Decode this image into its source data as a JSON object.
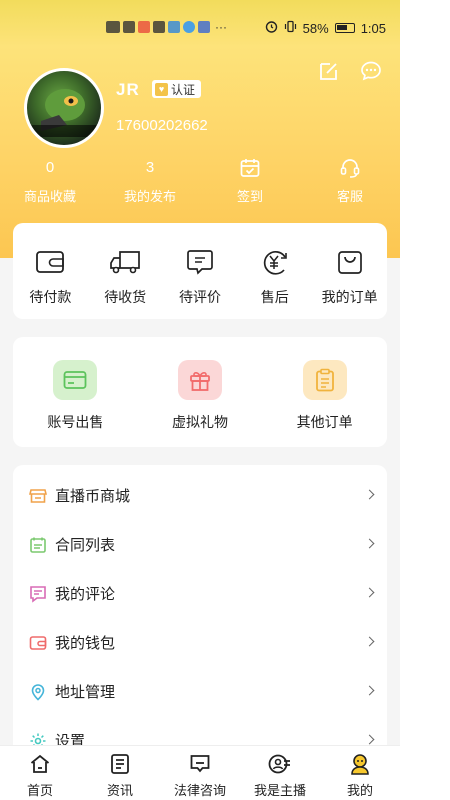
{
  "status_bar": {
    "battery": "58%",
    "time": "1:05",
    "more": "···"
  },
  "profile": {
    "name": "JR",
    "verify_label": "认证",
    "phone": "17600202662"
  },
  "stats": [
    {
      "value": "0",
      "label": "商品收藏"
    },
    {
      "value": "3",
      "label": "我的发布"
    },
    {
      "icon": "calendar-check-icon",
      "label": "签到"
    },
    {
      "icon": "headset-icon",
      "label": "客服"
    }
  ],
  "orders": [
    {
      "icon": "wallet-icon",
      "label": "待付款"
    },
    {
      "icon": "truck-icon",
      "label": "待收货"
    },
    {
      "icon": "comment-icon",
      "label": "待评价"
    },
    {
      "icon": "yuan-refund-icon",
      "label": "售后"
    },
    {
      "icon": "bag-icon",
      "label": "我的订单"
    }
  ],
  "services": [
    {
      "icon": "card-icon",
      "label": "账号出售",
      "color": "#5cc35c"
    },
    {
      "icon": "gift-icon",
      "label": "虚拟礼物",
      "color": "#f26b6b"
    },
    {
      "icon": "clipboard-icon",
      "label": "其他订单",
      "color": "#f0b33d"
    }
  ],
  "menu": [
    {
      "icon": "store-icon",
      "label": "直播币商城"
    },
    {
      "icon": "contract-icon",
      "label": "合同列表"
    },
    {
      "icon": "review-icon",
      "label": "我的评论"
    },
    {
      "icon": "wallet-icon",
      "label": "我的钱包"
    },
    {
      "icon": "location-icon",
      "label": "地址管理"
    },
    {
      "icon": "settings-icon",
      "label": "设置"
    }
  ],
  "tabs": [
    {
      "icon": "home-icon",
      "label": "首页"
    },
    {
      "icon": "news-icon",
      "label": "资讯"
    },
    {
      "icon": "legal-chat-icon",
      "label": "法律咨询"
    },
    {
      "icon": "anchor-icon",
      "label": "我是主播"
    },
    {
      "icon": "profile-icon",
      "label": "我的"
    }
  ],
  "colors": {
    "hero_yellow": "#fed467",
    "accent_orange": "#f0a24a"
  }
}
